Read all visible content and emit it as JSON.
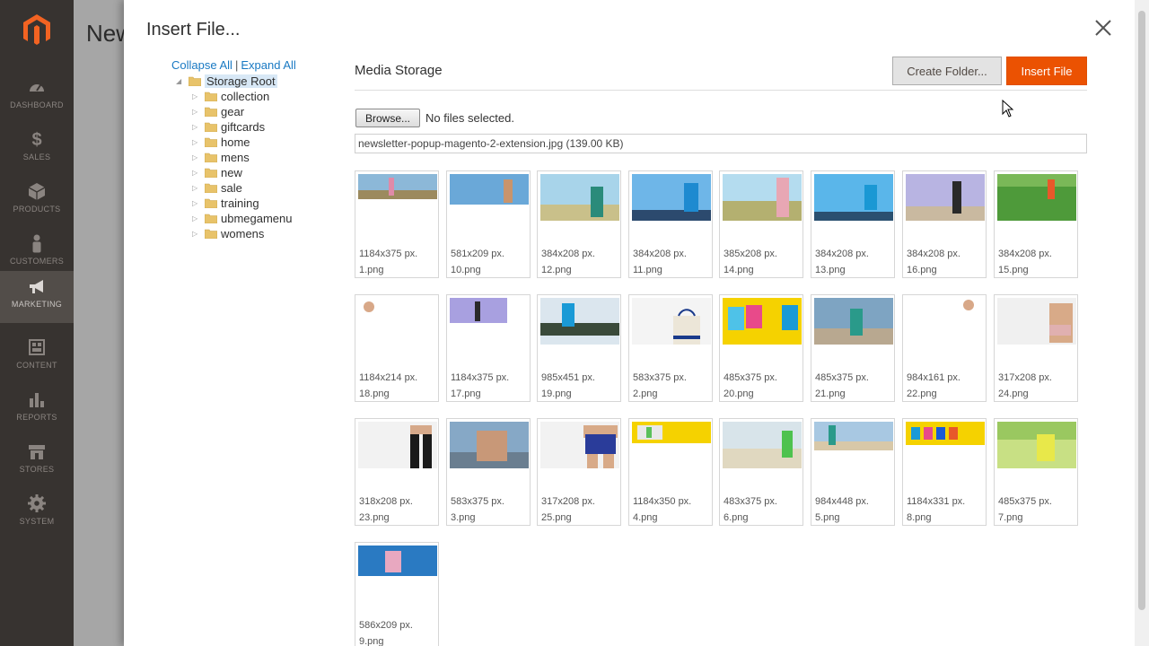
{
  "admin_nav": {
    "items": [
      {
        "label": "DASHBOARD",
        "icon": "speedometer-icon"
      },
      {
        "label": "SALES",
        "icon": "dollar-icon"
      },
      {
        "label": "PRODUCTS",
        "icon": "box-icon"
      },
      {
        "label": "CUSTOMERS",
        "icon": "person-icon"
      },
      {
        "label": "MARKETING",
        "icon": "megaphone-icon",
        "active": true
      },
      {
        "label": "CONTENT",
        "icon": "content-grid-icon"
      },
      {
        "label": "REPORTS",
        "icon": "bar-chart-icon"
      },
      {
        "label": "STORES",
        "icon": "storefront-icon"
      },
      {
        "label": "SYSTEM",
        "icon": "gear-icon"
      }
    ]
  },
  "behind_page": {
    "title": "New"
  },
  "modal": {
    "title": "Insert File...",
    "close_icon": "close-icon",
    "tree": {
      "collapse_all": "Collapse All",
      "separator": "|",
      "expand_all": "Expand All",
      "root": "Storage Root",
      "folders": [
        "collection",
        "gear",
        "giftcards",
        "home",
        "mens",
        "new",
        "sale",
        "training",
        "ubmegamenu",
        "womens"
      ]
    },
    "heading": "Media Storage",
    "create_folder": "Create Folder...",
    "insert_file": "Insert File",
    "browse": "Browse...",
    "no_files": "No files selected.",
    "uploaded_file": "newsletter-popup-magento-2-extension.jpg (139.00 KB)",
    "files": [
      {
        "dims": "1184x375 px.",
        "name": "1.png"
      },
      {
        "dims": "581x209 px.",
        "name": "10.png"
      },
      {
        "dims": "384x208 px.",
        "name": "12.png"
      },
      {
        "dims": "384x208 px.",
        "name": "11.png"
      },
      {
        "dims": "385x208 px.",
        "name": "14.png"
      },
      {
        "dims": "384x208 px.",
        "name": "13.png"
      },
      {
        "dims": "384x208 px.",
        "name": "16.png"
      },
      {
        "dims": "384x208 px.",
        "name": "15.png"
      },
      {
        "dims": "1184x214 px.",
        "name": "18.png"
      },
      {
        "dims": "1184x375 px.",
        "name": "17.png"
      },
      {
        "dims": "985x451 px.",
        "name": "19.png"
      },
      {
        "dims": "583x375 px.",
        "name": "2.png"
      },
      {
        "dims": "485x375 px.",
        "name": "20.png"
      },
      {
        "dims": "485x375 px.",
        "name": "21.png"
      },
      {
        "dims": "984x161 px.",
        "name": "22.png"
      },
      {
        "dims": "317x208 px.",
        "name": "24.png"
      },
      {
        "dims": "318x208 px.",
        "name": "23.png"
      },
      {
        "dims": "583x375 px.",
        "name": "3.png"
      },
      {
        "dims": "317x208 px.",
        "name": "25.png"
      },
      {
        "dims": "1184x350 px.",
        "name": "4.png"
      },
      {
        "dims": "483x375 px.",
        "name": "6.png"
      },
      {
        "dims": "984x448 px.",
        "name": "5.png"
      },
      {
        "dims": "1184x331 px.",
        "name": "8.png"
      },
      {
        "dims": "485x375 px.",
        "name": "7.png"
      },
      {
        "dims": "586x209 px.",
        "name": "9.png"
      }
    ]
  },
  "colors": {
    "accent_orange": "#eb5202",
    "link_blue": "#1979c3",
    "sidebar_bg": "#373330",
    "folder_yellow": "#e8c36a"
  }
}
